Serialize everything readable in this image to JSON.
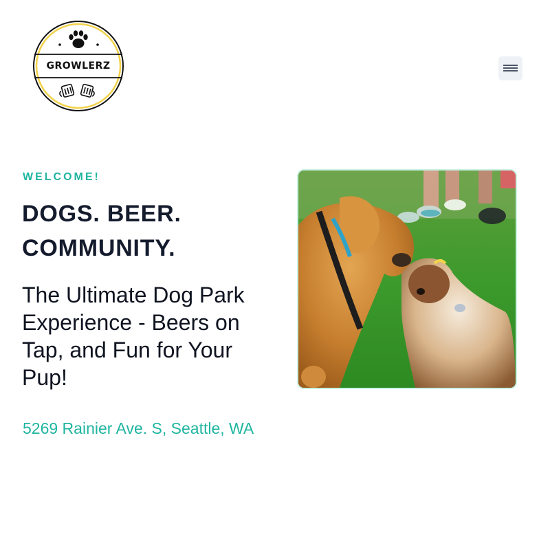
{
  "header": {
    "logo_text": "GROWLERZ",
    "menu_icon": "hamburger-menu-icon"
  },
  "hero": {
    "eyebrow": "WELCOME!",
    "headline": "DOGS. BEER. COMMUNITY.",
    "subheadline": "The Ultimate Dog Park Experience - Beers on Tap, and Fun for Your Pup!",
    "address": "5269 Rainier Ave. S, Seattle, WA"
  },
  "colors": {
    "accent": "#1fb5a0",
    "headline": "#141b2d",
    "logo_ring": "#f2d24b"
  }
}
